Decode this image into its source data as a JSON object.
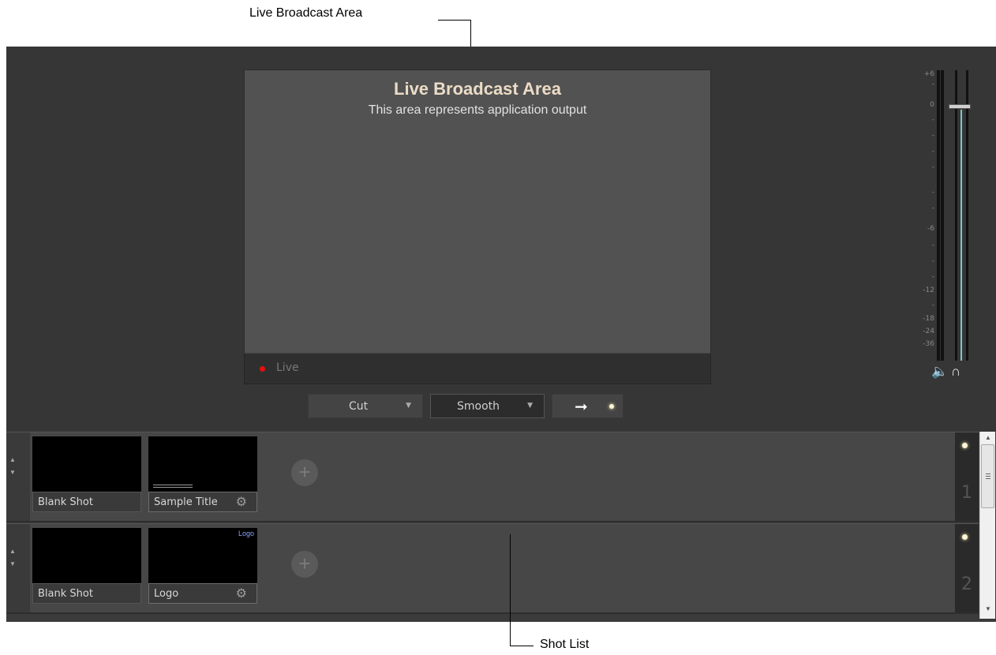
{
  "callouts": {
    "top_label": "Live Broadcast Area",
    "bottom_label": "Shot List"
  },
  "preview": {
    "title": "Live Broadcast Area",
    "subtitle": "This area represents application output",
    "status_label": "Live",
    "status_color": "#e51010"
  },
  "transition": {
    "mode": "Cut",
    "speed": "Smooth",
    "go_icon": "right-arrow-icon"
  },
  "meter": {
    "scale": [
      "+6",
      "-",
      "0",
      "-",
      "-",
      "-",
      "-",
      "-",
      "-",
      "-6",
      "-",
      "-",
      "-",
      "-12",
      "-",
      "-18",
      "-24",
      "-36"
    ],
    "speaker_icon": "speaker-icon",
    "headphones_icon": "headphones-icon",
    "level_color": "#7ec8c9"
  },
  "shotlist": {
    "rows": [
      {
        "number": "1",
        "shots": [
          {
            "label": "Blank Shot",
            "has_gear": false
          },
          {
            "label": "Sample Title",
            "has_gear": true
          }
        ]
      },
      {
        "number": "2",
        "shots": [
          {
            "label": "Blank Shot",
            "has_gear": false
          },
          {
            "label": "Logo",
            "has_gear": true,
            "overlay_text": "Logo"
          }
        ]
      }
    ],
    "add_label": "+"
  }
}
